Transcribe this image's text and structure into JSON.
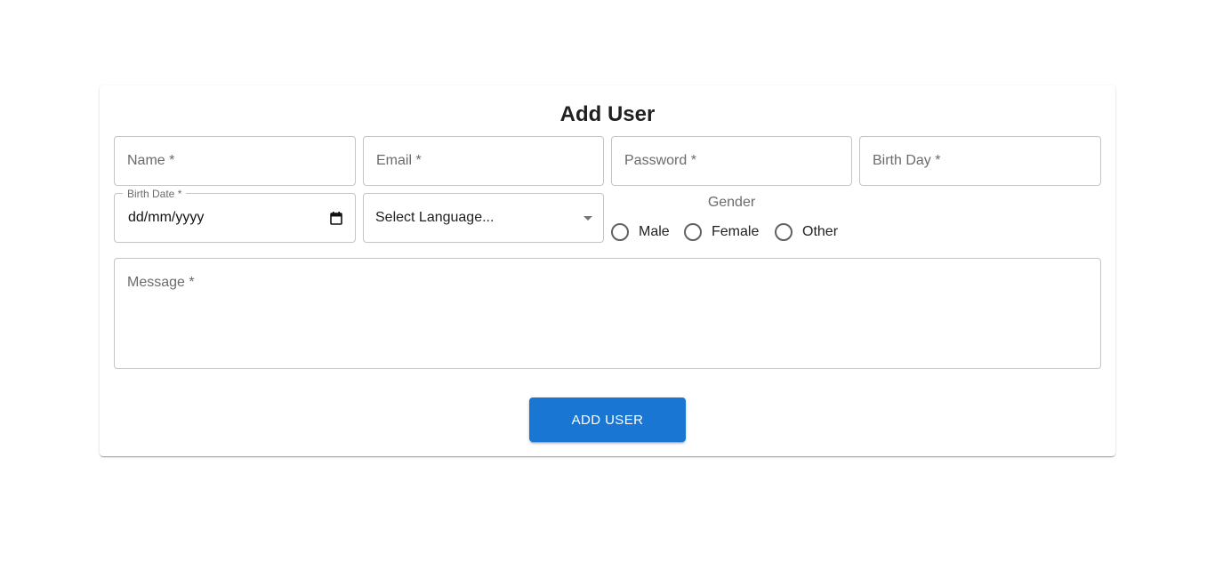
{
  "form": {
    "title": "Add User",
    "name_placeholder": "Name *",
    "email_placeholder": "Email *",
    "password_placeholder": "Password *",
    "birthday_placeholder": "Birth Day *",
    "birthdate_label": "Birth Date *",
    "birthdate_value": "dd/mm/yyyy",
    "language_value": "Select Language...",
    "gender_label": "Gender",
    "gender_options": [
      "Male",
      "Female",
      "Other"
    ],
    "message_placeholder": "Message *",
    "submit_label": "ADD USER"
  },
  "colors": {
    "primary": "#1976d2",
    "border": "#c4c4c4",
    "placeholder": "#6b6b6b"
  }
}
